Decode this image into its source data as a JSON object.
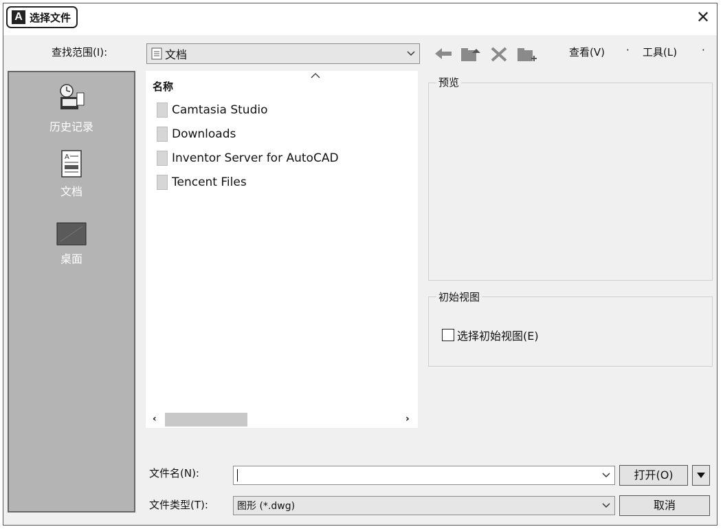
{
  "window": {
    "title": "选择文件",
    "app_logo_letter": "A",
    "close_glyph": "✕"
  },
  "toolbar": {
    "look_in_label": "查找范围(I):",
    "look_in_value": "文档",
    "view_menu": "查看(V)",
    "tools_menu": "工具(L)",
    "menu_dot": "·"
  },
  "places": [
    {
      "label": "历史记录",
      "icon": "history-icon"
    },
    {
      "label": "文档",
      "icon": "documents-icon"
    },
    {
      "label": "桌面",
      "icon": "desktop-icon"
    }
  ],
  "file_list": {
    "column_header": "名称",
    "items": [
      "Camtasia Studio",
      "Downloads",
      "Inventor Server for AutoCAD",
      "Tencent Files"
    ]
  },
  "preview": {
    "label": "预览"
  },
  "initial_view": {
    "group_label": "初始视图",
    "checkbox_label": "选择初始视图(E)",
    "checked": false
  },
  "bottom": {
    "filename_label": "文件名(N):",
    "filename_value": "",
    "filetype_label": "文件类型(T):",
    "filetype_value": "图形 (*.dwg)",
    "open_button": "打开(O)",
    "cancel_button": "取消"
  },
  "scroll": {
    "left_glyph": "‹",
    "right_glyph": "›"
  },
  "colors": {
    "places_bg": "#b4b4b4",
    "dialog_bg": "#f0f0f0",
    "icon_gray": "#8a8a8a"
  }
}
